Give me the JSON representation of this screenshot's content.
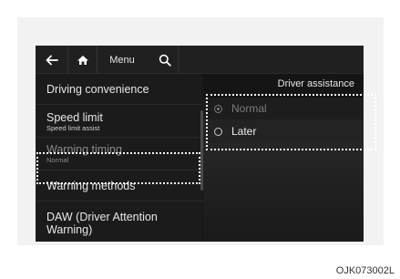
{
  "topbar": {
    "back_icon": "left-arrow-icon",
    "home_icon": "home-icon",
    "menu_label": "Menu",
    "search_icon": "search-icon"
  },
  "left_menu": {
    "items": [
      {
        "title": "Driving convenience",
        "subtitle": ""
      },
      {
        "title": "Speed limit",
        "subtitle": "Speed limit assist"
      },
      {
        "title": "Warning timing",
        "subtitle": "Normal"
      },
      {
        "title": "Warning methods",
        "subtitle": ""
      },
      {
        "title": "DAW (Driver Attention Warning)",
        "subtitle": ""
      }
    ]
  },
  "right_panel": {
    "header": "Driver assistance",
    "options": [
      {
        "label": "Normal",
        "selected": true
      },
      {
        "label": "Later",
        "selected": false
      }
    ]
  },
  "figure_code": "OJK073002L",
  "colors": {
    "screen_bg": "#161616",
    "highlight_border": "#ffffff",
    "dimmed_text": "#8a8a8a"
  }
}
